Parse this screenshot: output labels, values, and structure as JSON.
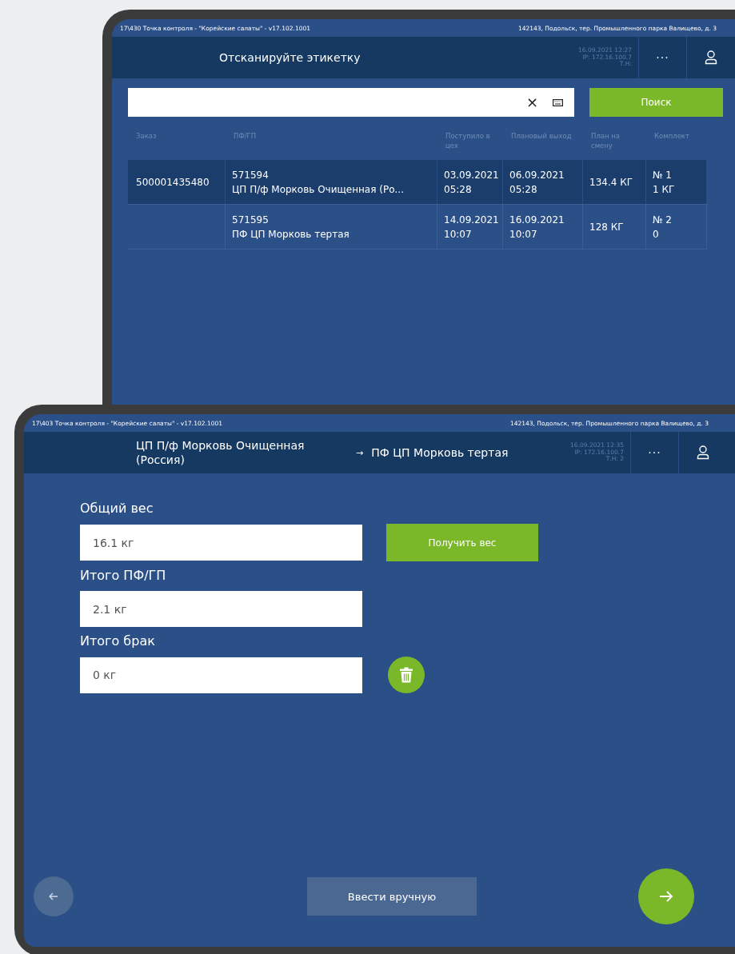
{
  "screens": [
    {
      "kind": "scan",
      "status_bar": {
        "left": "17\\430  Точка контроля - \"Корейские салаты\" - v17.102.1001",
        "right": "142143, Подольск, тер. Промышленного парка Валищево, д. 3"
      },
      "header": {
        "title": "Отсканируйте этикетку",
        "datetime": "16.09.2021 12:27",
        "ip": "IP: 172.16.100.7",
        "terminal": "Т.Н:",
        "menu": "···"
      },
      "search": {
        "clear": "×",
        "button": "Поиск"
      },
      "table": {
        "columns": [
          "Заказ",
          "ПФ/ГП",
          "Поступило в цех",
          "Плановый выход",
          "План на смену",
          "Комплект"
        ],
        "rows": [
          {
            "selected": true,
            "cells": [
              [
                "500001435480"
              ],
              [
                "571594",
                "ЦП П/ф Морковь Очищенная (Ро..."
              ],
              [
                "03.09.2021",
                "05:28"
              ],
              [
                "06.09.2021",
                "05:28"
              ],
              [
                "134.4 КГ"
              ],
              [
                "№ 1",
                "1 КГ"
              ]
            ]
          },
          {
            "selected": false,
            "cells": [
              [],
              [
                "571595",
                "ПФ ЦП Морковь тертая"
              ],
              [
                "14.09.2021",
                "10:07"
              ],
              [
                "16.09.2021",
                "10:07"
              ],
              [
                "128 КГ"
              ],
              [
                "№ 2",
                "0"
              ]
            ]
          }
        ]
      }
    },
    {
      "kind": "weigh",
      "status_bar": {
        "left": "17\\403  Точка контроля - \"Корейские салаты\" - v17.102.1001",
        "right": "142143, Подольск, тер. Промышленного парка Валищево, д. 3"
      },
      "header": {
        "title_from": "ЦП П/ф Морковь Очищенная (Россия)",
        "arrow": "→",
        "title_to": "ПФ ЦП Морковь тертая",
        "datetime": "16.09.2021 12:35",
        "ip": "IP: 172.16.100.7",
        "terminal": "Т.Н: 2",
        "menu": "···"
      },
      "fields": [
        {
          "label": "Общий вес",
          "value": "16.1 кг",
          "kind": "button",
          "button": "Получить вес"
        },
        {
          "label": "Итого ПФ/ГП",
          "value": "2.1 кг",
          "kind": "plain"
        },
        {
          "label": "Итого брак",
          "value": "0 кг",
          "kind": "trash"
        }
      ],
      "manual_button": "Ввести вручную"
    }
  ]
}
